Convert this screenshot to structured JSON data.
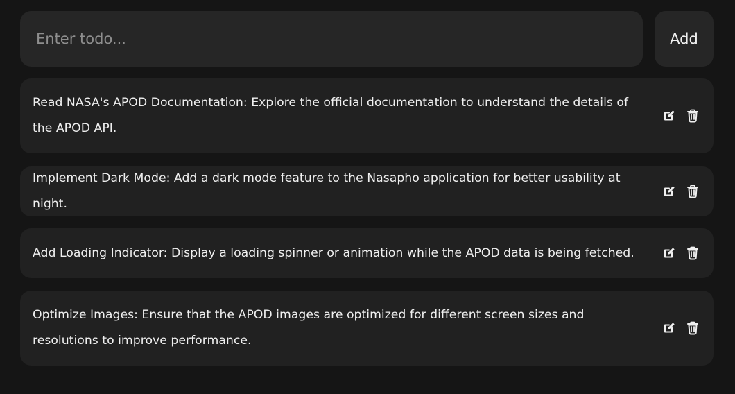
{
  "input": {
    "placeholder": "Enter todo...",
    "value": ""
  },
  "add_button": {
    "label": "Add"
  },
  "todos": [
    {
      "text": "Read NASA's APOD Documentation: Explore the official documentation to understand the details of the APOD API.",
      "edit_icon": "edit-icon",
      "delete_icon": "trash-icon"
    },
    {
      "text": "Implement Dark Mode: Add a dark mode feature to the Nasapho application for better usability at night.",
      "edit_icon": "edit-icon",
      "delete_icon": "trash-icon"
    },
    {
      "text": "Add Loading Indicator: Display a loading spinner or animation while the APOD data is being fetched.",
      "edit_icon": "edit-icon",
      "delete_icon": "trash-icon"
    },
    {
      "text": "Optimize Images: Ensure that the APOD images are optimized for different screen sizes and resolutions to improve performance.",
      "edit_icon": "edit-icon",
      "delete_icon": "trash-icon"
    }
  ],
  "colors": {
    "background": "#151515",
    "input_background": "#262626",
    "item_background": "#212121",
    "text": "#efefef",
    "icon": "#f0f0f0"
  }
}
